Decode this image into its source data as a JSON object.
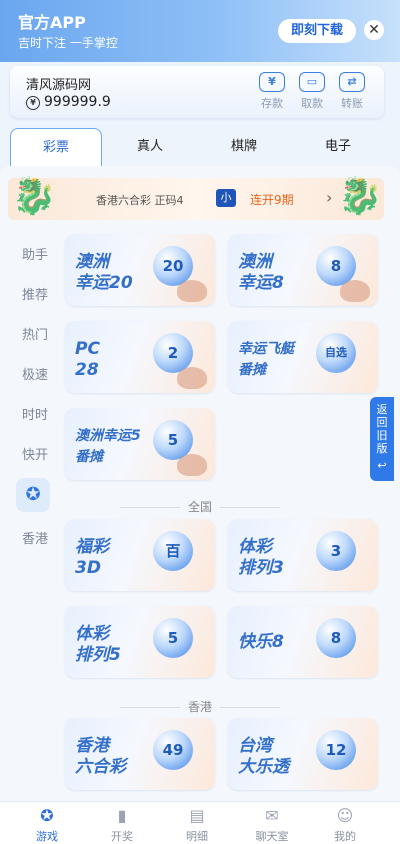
{
  "banner": {
    "title": "官方APP",
    "subtitle": "吉时下注 一手掌控",
    "download_label": "即刻下载",
    "close_icon": "close-icon",
    "accent": "#6aa6ef"
  },
  "account": {
    "site_name": "清风源码网",
    "balance": "999999.9",
    "actions": [
      {
        "label": "存款",
        "icon": "wallet-icon",
        "glyph": "¥"
      },
      {
        "label": "取款",
        "icon": "card-icon",
        "glyph": "▭"
      },
      {
        "label": "转账",
        "icon": "transfer-icon",
        "glyph": "⇄"
      }
    ]
  },
  "tabs": [
    {
      "label": "彩票",
      "active": true
    },
    {
      "label": "真人",
      "active": false
    },
    {
      "label": "棋牌",
      "active": false
    },
    {
      "label": "电子",
      "active": false
    }
  ],
  "promo": {
    "text": "香港六合彩 正码4",
    "badge": "小",
    "streak": "连开9期"
  },
  "side_menu": {
    "items": [
      "助手",
      "推荐",
      "热门",
      "极速",
      "时时",
      "快开"
    ],
    "active_glyph": "✪",
    "last": "香港"
  },
  "cards_fast": [
    {
      "line1": "澳洲",
      "line2": "幸运20",
      "ball": "20"
    },
    {
      "line1": "澳洲",
      "line2": "幸运8",
      "ball": "8"
    },
    {
      "line1": "PC",
      "line2": "28",
      "ball": "2"
    },
    {
      "line1": "幸运飞艇",
      "line2": "番摊",
      "ball": "自选"
    },
    {
      "line1": "澳洲幸运5",
      "line2": "番摊",
      "ball": "5"
    }
  ],
  "section_national": "全国",
  "cards_national": [
    {
      "line1": "福彩",
      "line2": "3D",
      "ball": "百"
    },
    {
      "line1": "体彩",
      "line2": "排列3",
      "ball": "3"
    },
    {
      "line1": "体彩",
      "line2": "排列5",
      "ball": "5"
    },
    {
      "line1": "快乐8",
      "line2": "",
      "ball": "8"
    }
  ],
  "section_hk": "香港",
  "cards_hk": [
    {
      "line1": "香港",
      "line2": "六合彩",
      "ball": "49"
    },
    {
      "line1": "台湾",
      "line2": "大乐透",
      "ball": "12"
    }
  ],
  "back_old": "返回旧版",
  "back_old_arrow": "↩",
  "bottom_nav": [
    {
      "label": "游戏",
      "icon": "game-icon",
      "glyph": "✪",
      "active": true
    },
    {
      "label": "开奖",
      "icon": "chart-icon",
      "glyph": "▮",
      "active": false
    },
    {
      "label": "明细",
      "icon": "document-icon",
      "glyph": "▤",
      "active": false
    },
    {
      "label": "聊天室",
      "icon": "chat-icon",
      "glyph": "✉",
      "active": false
    },
    {
      "label": "我的",
      "icon": "user-icon",
      "glyph": "☺",
      "active": false
    }
  ]
}
